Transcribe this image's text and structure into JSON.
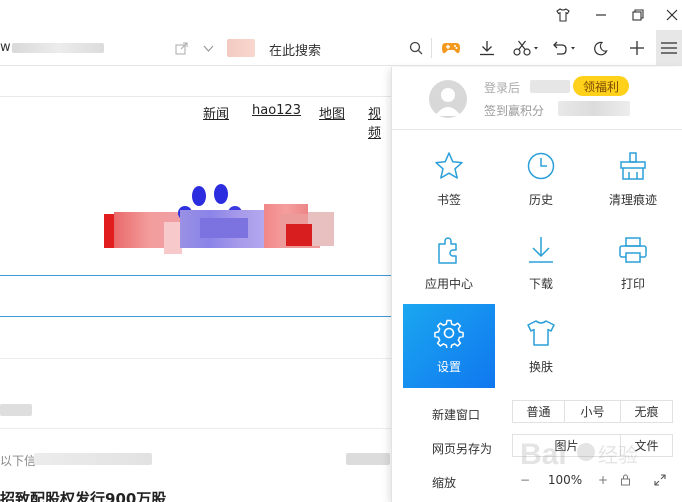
{
  "titlebar": {
    "buttons": [
      "skin",
      "minimize",
      "restore",
      "close"
    ]
  },
  "toolbar": {
    "url_prefix": "w",
    "search_placeholder": "在此搜索",
    "icons": [
      "share-icon",
      "chevron-down-icon",
      "search-icon",
      "game-icon",
      "download-icon",
      "scissors-icon",
      "undo-icon",
      "moon-icon",
      "plus-icon",
      "menu-icon"
    ]
  },
  "page": {
    "nav": [
      "新闻",
      "hao123",
      "地图",
      "视频"
    ],
    "bottom_headline": "招致配股权发行900万股",
    "bottom_snippet": "以下信"
  },
  "menu": {
    "user": {
      "name": "登录后",
      "subtitle": "签到赢积分",
      "badge": "领福利"
    },
    "grid": [
      {
        "label": "书签",
        "icon": "star-icon"
      },
      {
        "label": "历史",
        "icon": "clock-icon"
      },
      {
        "label": "清理痕迹",
        "icon": "broom-icon"
      },
      {
        "label": "应用中心",
        "icon": "puzzle-icon"
      },
      {
        "label": "下载",
        "icon": "download-icon"
      },
      {
        "label": "打印",
        "icon": "printer-icon"
      },
      {
        "label": "设置",
        "icon": "gear-icon",
        "active": true
      },
      {
        "label": "换肤",
        "icon": "shirt-icon"
      }
    ],
    "rows": [
      {
        "label": "新建窗口",
        "options": [
          "普通",
          "小号",
          "无痕"
        ]
      },
      {
        "label": "网页另存为",
        "options": [
          "图片",
          "文件"
        ]
      },
      {
        "label": "缩放",
        "zoom": {
          "minus": "−",
          "value": "100%",
          "plus": "+"
        }
      }
    ]
  },
  "colors": {
    "accent": "#1e9bf0",
    "active_tile": "#1f8ef1",
    "badge": "#ffd11a",
    "icon": "#2a9fd8"
  }
}
